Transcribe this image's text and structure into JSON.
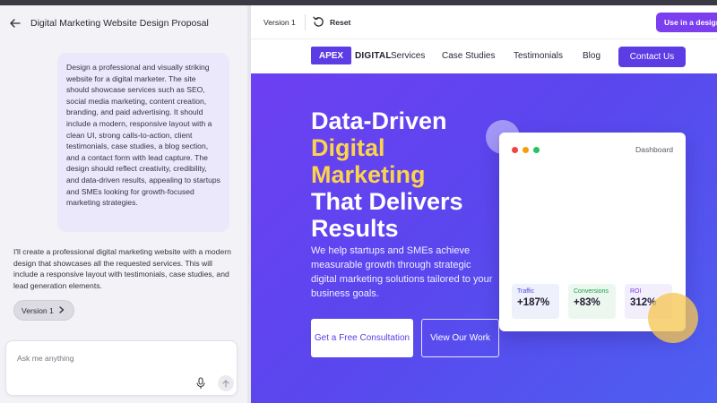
{
  "chat": {
    "title": "Digital Marketing Website Design Proposal",
    "user_message": "Design a professional and visually striking website for a digital marketer. The site should showcase services such as SEO, social media marketing, content creation, branding, and paid advertising. It should include a modern, responsive layout with a clean UI, strong calls-to-action, client testimonials, case studies, a blog section, and a contact form with lead capture. The design should reflect creativity, credibility, and data-driven results, appealing to startups and SMEs looking for growth-focused marketing strategies.",
    "assistant_message": "I'll create a professional digital marketing website with a modern design that showcases all the requested services. This will include a responsive layout with testimonials, case studies, and lead generation elements.",
    "version_chip": "Version 1",
    "composer_placeholder": "Ask me anything"
  },
  "toolbar": {
    "version_label": "Version 1",
    "reset_label": "Reset",
    "use_design_label": "Use in a design"
  },
  "site": {
    "logo_box": "APEX",
    "logo_text": "DIGITAL",
    "nav": [
      "Services",
      "Case Studies",
      "Testimonials",
      "Blog"
    ],
    "contact": "Contact Us",
    "hero": {
      "line1": "Data-Driven",
      "line2": "Digital",
      "line3": "Marketing",
      "line4": "That Delivers",
      "line5": "Results",
      "subtitle": "We help startups and SMEs achieve measurable growth through strategic digital marketing solutions tailored to your business goals.",
      "primary_cta": "Get a Free Consultation",
      "secondary_cta": "View Our Work"
    },
    "dashboard": {
      "title": "Dashboard",
      "stats": [
        {
          "label": "Traffic",
          "value": "+187%",
          "color": "#4f46e5",
          "bg": "#eef0fb"
        },
        {
          "label": "Conversions",
          "value": "+83%",
          "color": "#16a34a",
          "bg": "#ecf7ef"
        },
        {
          "label": "ROI",
          "value": "312%",
          "color": "#7c3aed",
          "bg": "#f3eefc"
        }
      ],
      "window_dots": [
        "#ef4444",
        "#f59e0b",
        "#22c55e"
      ]
    }
  },
  "colors": {
    "brand": "#5b3ce5",
    "accent_yellow": "#fcd34d",
    "use_design_button": "#7b3ff0"
  }
}
